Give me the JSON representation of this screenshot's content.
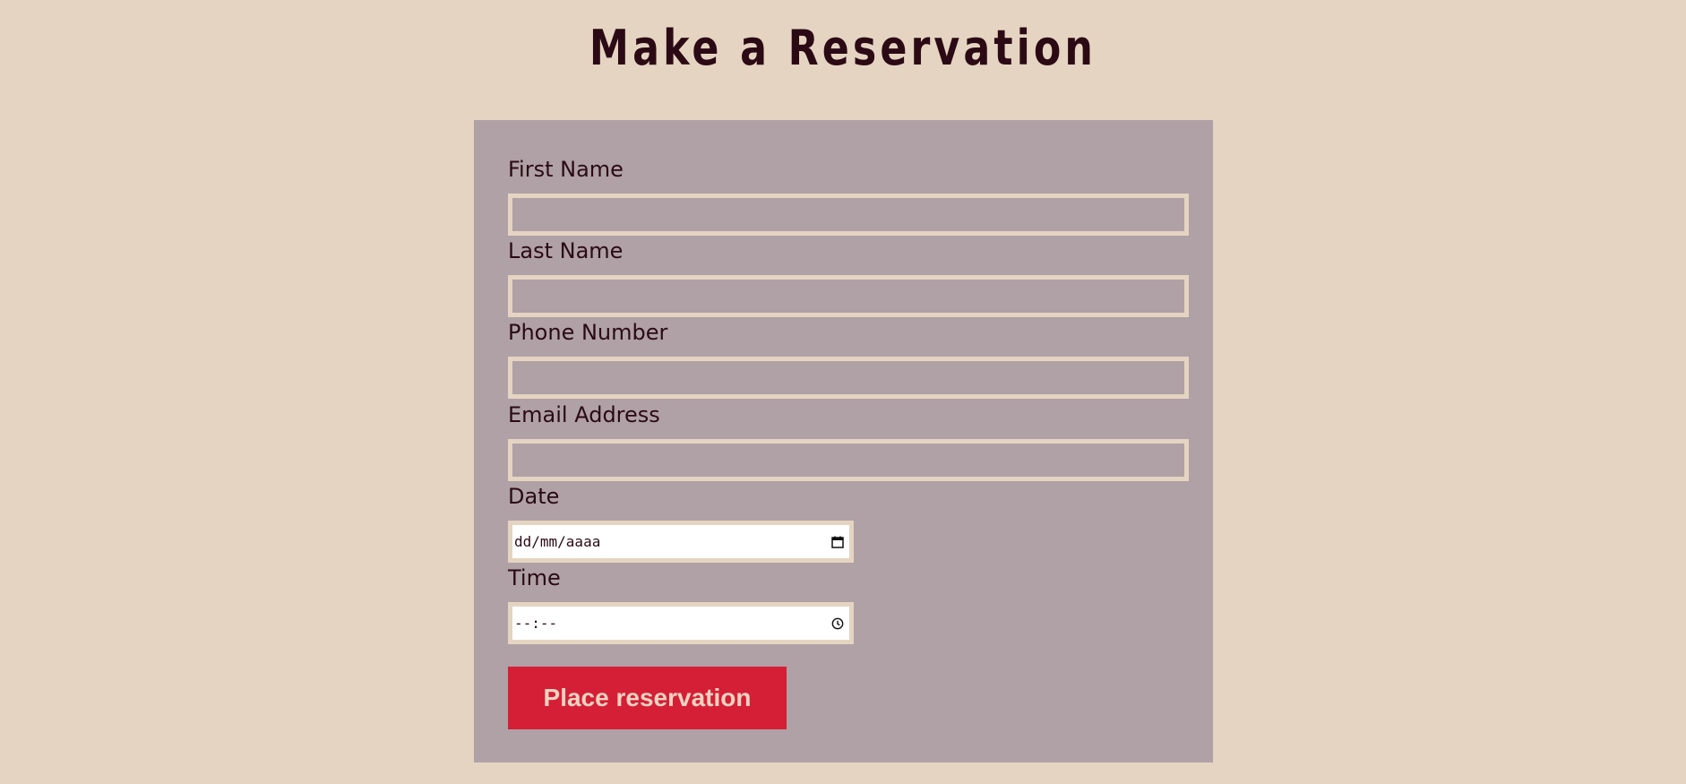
{
  "page": {
    "title": "Make a Reservation"
  },
  "colors": {
    "background": "#e5d4c1",
    "card": "#afa1a6",
    "text": "#2b0a15",
    "button": "#d41f36",
    "button_text": "#f2d2c1"
  },
  "form": {
    "fields": [
      {
        "label": "First Name",
        "value": "",
        "placeholder": ""
      },
      {
        "label": "Last Name",
        "value": "",
        "placeholder": ""
      },
      {
        "label": "Phone Number",
        "value": "",
        "placeholder": ""
      },
      {
        "label": "Email Address",
        "value": "",
        "placeholder": ""
      }
    ],
    "date": {
      "label": "Date",
      "placeholder": "dd/mm/aaaa",
      "icon": "calendar-icon"
    },
    "time": {
      "label": "Time",
      "placeholder": "--:--",
      "icon": "clock-icon"
    },
    "submit_label": "Place reservation"
  }
}
